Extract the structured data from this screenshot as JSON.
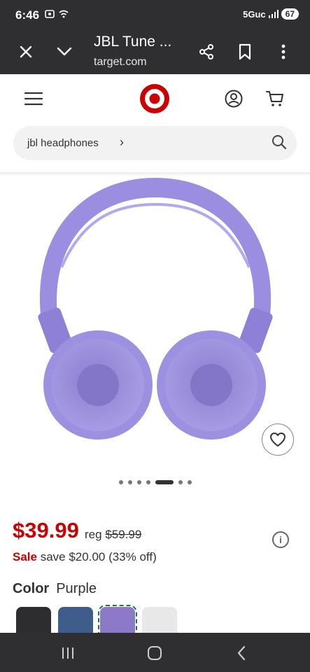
{
  "status_bar": {
    "time": "6:46",
    "network": "5Guc",
    "battery": "67"
  },
  "browser": {
    "title": "JBL Tune ...",
    "url": "target.com"
  },
  "search": {
    "query": "jbl headphones"
  },
  "product": {
    "price": "$39.99",
    "reg_label": "reg",
    "reg_price": "$59.99",
    "sale_label": "Sale",
    "save_text": "save $20.00 (33% off)",
    "color_label": "Color",
    "color_value": "Purple",
    "image_count": 7,
    "active_image_index": 4,
    "swatches": [
      {
        "color": "#2d2d2f"
      },
      {
        "color": "#3f5d8a"
      },
      {
        "color": "#8c7ac8"
      },
      {
        "color": "#e8e8e8"
      }
    ]
  },
  "colors": {
    "brand": "#cc0000",
    "chrome": "#2f2f31",
    "product": "#9b8ee0"
  }
}
